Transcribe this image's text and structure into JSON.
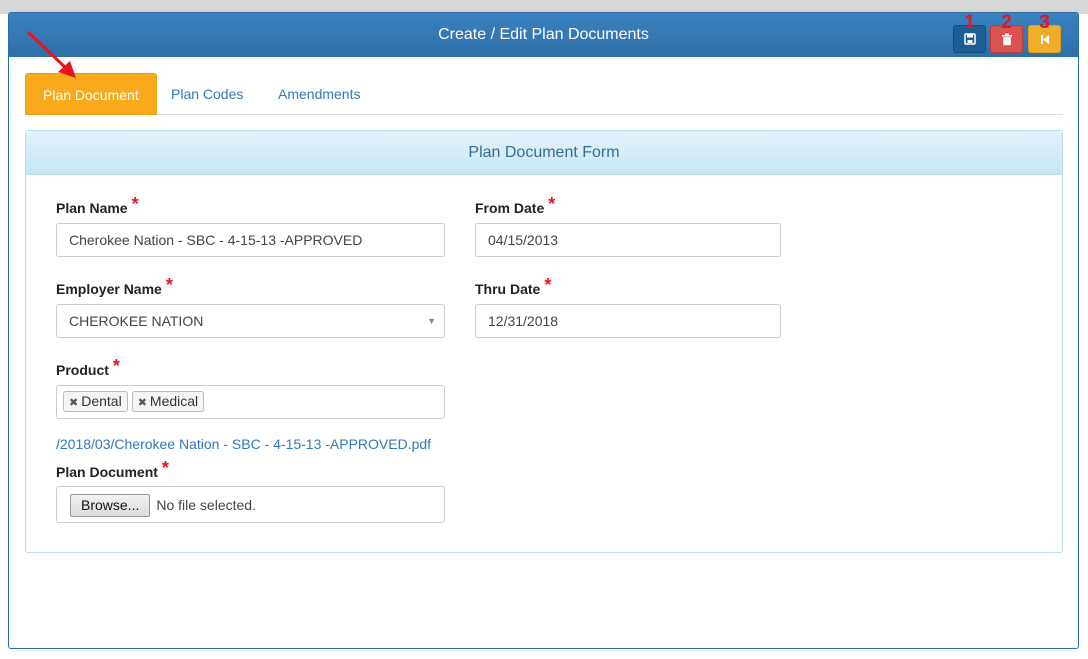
{
  "window": {
    "title": "Create / Edit Plan Documents"
  },
  "toolbar": {
    "save_icon": "save-icon",
    "delete_icon": "trash-icon",
    "back_icon": "step-backward-icon",
    "annotations": [
      "1",
      "2",
      "3"
    ]
  },
  "tabs": [
    {
      "label": "Plan Document",
      "active": true
    },
    {
      "label": "Plan Codes",
      "active": false
    },
    {
      "label": "Amendments",
      "active": false
    }
  ],
  "form": {
    "title": "Plan Document Form",
    "required_mark": "*",
    "plan_name": {
      "label": "Plan Name",
      "value": "Cherokee Nation - SBC  -  4-15-13 -APPROVED"
    },
    "from_date": {
      "label": "From Date",
      "value": "04/15/2013"
    },
    "employer_name": {
      "label": "Employer Name",
      "value": "CHEROKEE NATION"
    },
    "thru_date": {
      "label": "Thru Date",
      "value": "12/31/2018"
    },
    "product": {
      "label": "Product",
      "tags": [
        "Dental",
        "Medical"
      ]
    },
    "file_link": "/2018/03/Cherokee Nation - SBC - 4-15-13 -APPROVED.pdf",
    "plan_document": {
      "label": "Plan Document",
      "browse_label": "Browse...",
      "status": "No file selected."
    }
  },
  "colors": {
    "header": "#337ab7",
    "active_tab": "#f8a91c",
    "delete": "#d9534f",
    "back": "#f0ad2c",
    "annotation": "#e8141b"
  }
}
